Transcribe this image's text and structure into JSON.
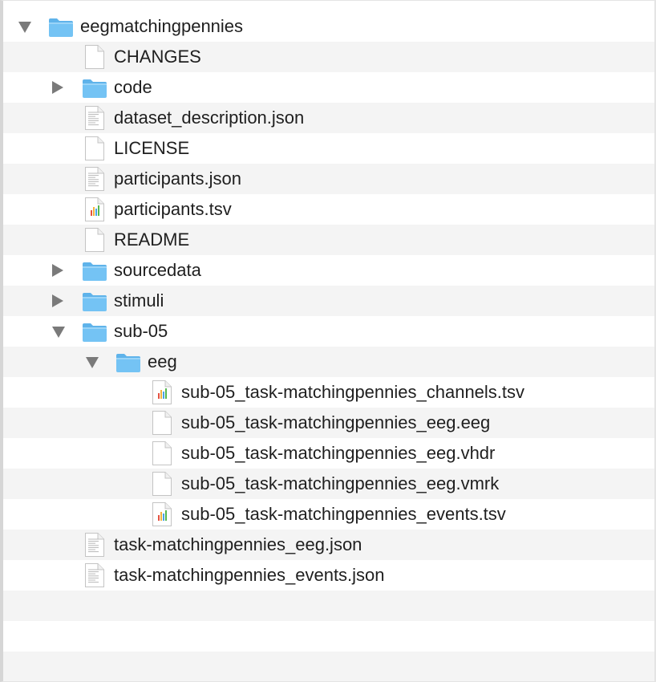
{
  "tree": {
    "rows": [
      {
        "label": "eegmatchingpennies",
        "kind": "folder",
        "depth": 0,
        "expanded": true
      },
      {
        "label": "CHANGES",
        "kind": "file",
        "depth": 1
      },
      {
        "label": "code",
        "kind": "folder",
        "depth": 1,
        "expanded": false
      },
      {
        "label": "dataset_description.json",
        "kind": "text-file",
        "depth": 1
      },
      {
        "label": "LICENSE",
        "kind": "file",
        "depth": 1
      },
      {
        "label": "participants.json",
        "kind": "text-file",
        "depth": 1
      },
      {
        "label": "participants.tsv",
        "kind": "chart-file",
        "depth": 1
      },
      {
        "label": "README",
        "kind": "file",
        "depth": 1
      },
      {
        "label": "sourcedata",
        "kind": "folder",
        "depth": 1,
        "expanded": false
      },
      {
        "label": "stimuli",
        "kind": "folder",
        "depth": 1,
        "expanded": false
      },
      {
        "label": "sub-05",
        "kind": "folder",
        "depth": 1,
        "expanded": true
      },
      {
        "label": "eeg",
        "kind": "folder",
        "depth": 2,
        "expanded": true
      },
      {
        "label": "sub-05_task-matchingpennies_channels.tsv",
        "kind": "chart-file",
        "depth": 3
      },
      {
        "label": "sub-05_task-matchingpennies_eeg.eeg",
        "kind": "file",
        "depth": 3
      },
      {
        "label": "sub-05_task-matchingpennies_eeg.vhdr",
        "kind": "file",
        "depth": 3
      },
      {
        "label": "sub-05_task-matchingpennies_eeg.vmrk",
        "kind": "file",
        "depth": 3
      },
      {
        "label": "sub-05_task-matchingpennies_events.tsv",
        "kind": "chart-file",
        "depth": 3
      },
      {
        "label": "task-matchingpennies_eeg.json",
        "kind": "text-file",
        "depth": 1
      },
      {
        "label": "task-matchingpennies_events.json",
        "kind": "text-file",
        "depth": 1
      }
    ]
  },
  "colors": {
    "folder": "#74c3f4",
    "folder_tab": "#5fb3ea",
    "stripe": "#f4f4f4",
    "disclosure": "#7a7a7a",
    "text": "#1f1f1f"
  }
}
